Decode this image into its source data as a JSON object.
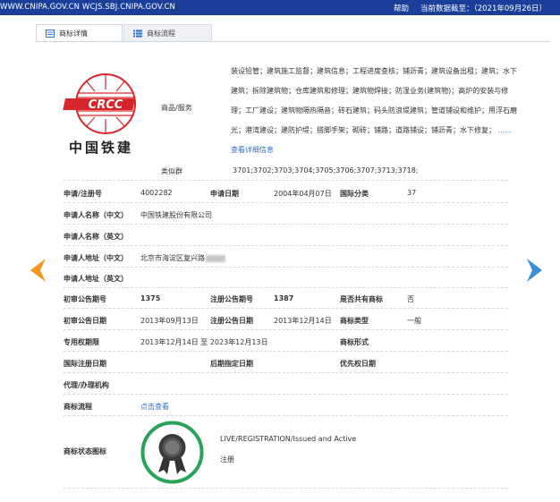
{
  "topbar": {
    "url": "WWW.CNIPA.GOV.CN WCJS.SBJ.CNIPA.GOV.CN",
    "help": "帮助",
    "data_as_of": "当前数据截至：（2021年09月26日）"
  },
  "tabs": [
    {
      "label": "商标详情",
      "active": true
    },
    {
      "label": "商标流程",
      "active": false
    }
  ],
  "logo": {
    "company_name": "中国铁建",
    "mark_text": "CRCC"
  },
  "goods_services": {
    "label": "商品/服务",
    "text": "装设铅管；建筑施工监督；建筑信息；工程进度查核；铺沥青；建筑设备出租；建筑；水下建筑；拆除建筑物；仓库建筑和修理；建筑物焊接；防湿业务(建筑物)；高炉的安装与修理；工厂建设；建筑物隔热隔音；砖石建筑；码头防浪堤建筑；管道铺设和维护；用浮石磨光；港湾建设；建防护堤；搭脚手架；砌砖；铺路；道路铺设；铺沥青；水下修复；",
    "ellipsis": "......",
    "more_link": "查看详细信息"
  },
  "similar_groups": {
    "label": "类似群",
    "value": "3701;3702;3703;3704;3705;3706;3707;3713;3718;"
  },
  "fields": {
    "reg_no_label": "申请/注册号",
    "reg_no": "4002282",
    "app_date_label": "申请日期",
    "app_date": "2004年04月07日",
    "intl_class_label": "国际分类",
    "intl_class": "37",
    "applicant_cn_label": "申请人名称（中文）",
    "applicant_cn": "中国铁建股份有限公司",
    "applicant_en_label": "申请人名称（英文）",
    "address_cn_label": "申请人地址（中文）",
    "address_cn": "北京市海淀区复兴路",
    "address_en_label": "申请人地址（英文）",
    "prelim_no_label": "初审公告期号",
    "prelim_no": "1375",
    "reg_pub_no_label": "注册公告期号",
    "reg_pub_no": "1387",
    "shared_label": "是否共有商标",
    "shared": "否",
    "prelim_date_label": "初审公告日期",
    "prelim_date": "2013年09月13日",
    "reg_pub_date_label": "注册公告日期",
    "reg_pub_date": "2013年12月14日",
    "mark_type_label": "商标类型",
    "mark_type": "一般",
    "exclusive_period_label": "专用权期限",
    "exclusive_period": "2013年12月14日 至 2023年12月13日",
    "mark_form_label": "商标形式",
    "intl_reg_date_label": "国际注册日期",
    "later_date_label": "后期指定日期",
    "priority_date_label": "优先权日期",
    "agency_label": "代理/办理机构",
    "process_label": "商标流程",
    "process_link": "点击查看",
    "status_icon_label": "商标状态图标",
    "status_text": "LIVE/REGISTRATION/Issued and Active",
    "status_sub": "注册"
  },
  "colors": {
    "topbar": "#1b3e9a",
    "link": "#2d6fc9",
    "arrow_left": "#f39a1e",
    "arrow_right": "#3a8fd8",
    "logo_red": "#d7262b",
    "status_ring": "#2aa35a"
  }
}
